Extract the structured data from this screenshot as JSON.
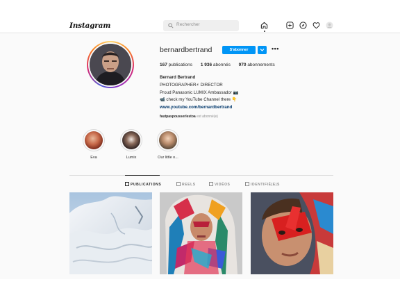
{
  "app": {
    "logo": "Instagram",
    "search_placeholder": "Rechercher"
  },
  "profile": {
    "username": "bernardbertrand",
    "follow_label": "S'abonner",
    "more_label": "•••",
    "stats": {
      "publications_count": "167",
      "publications_label": " publications",
      "followers_count": "1 936",
      "followers_label": " abonnés",
      "following_count": "970",
      "following_label": " abonnements"
    },
    "bio": {
      "name": "Bernard Bertrand",
      "line1": "PHOTOGRAPHER⚡ DIRECTOR",
      "line2": "Proud Panasonic LUMIX Ambassador 📷",
      "line3": "📹 check my YouTube Channel there 👇",
      "link": "www.youtube.com/bernardbertrand",
      "followed_by_user": "faut­pasp­ousserlestoa",
      "followed_by_suffix": " est abonné(e)"
    }
  },
  "highlights": [
    {
      "label": "Eva",
      "color": "#c84a2e"
    },
    {
      "label": "Lumix",
      "color": "#6a4a3a"
    },
    {
      "label": "Our little o...",
      "color": "#8a5a3a"
    }
  ],
  "tabs": [
    {
      "label": "PUBLICATIONS",
      "active": true
    },
    {
      "label": "REELS",
      "active": false
    },
    {
      "label": "VIDÉOS",
      "active": false
    },
    {
      "label": "IDENTIFIÉ(E)S",
      "active": false
    }
  ],
  "colors": {
    "accent": "#0095f6",
    "border": "#dbdbdb",
    "background": "#fafafa"
  },
  "icons": [
    "home-icon",
    "new-post-icon",
    "explore-icon",
    "heart-icon",
    "profile-avatar-icon",
    "search-icon",
    "chevron-down-icon"
  ]
}
